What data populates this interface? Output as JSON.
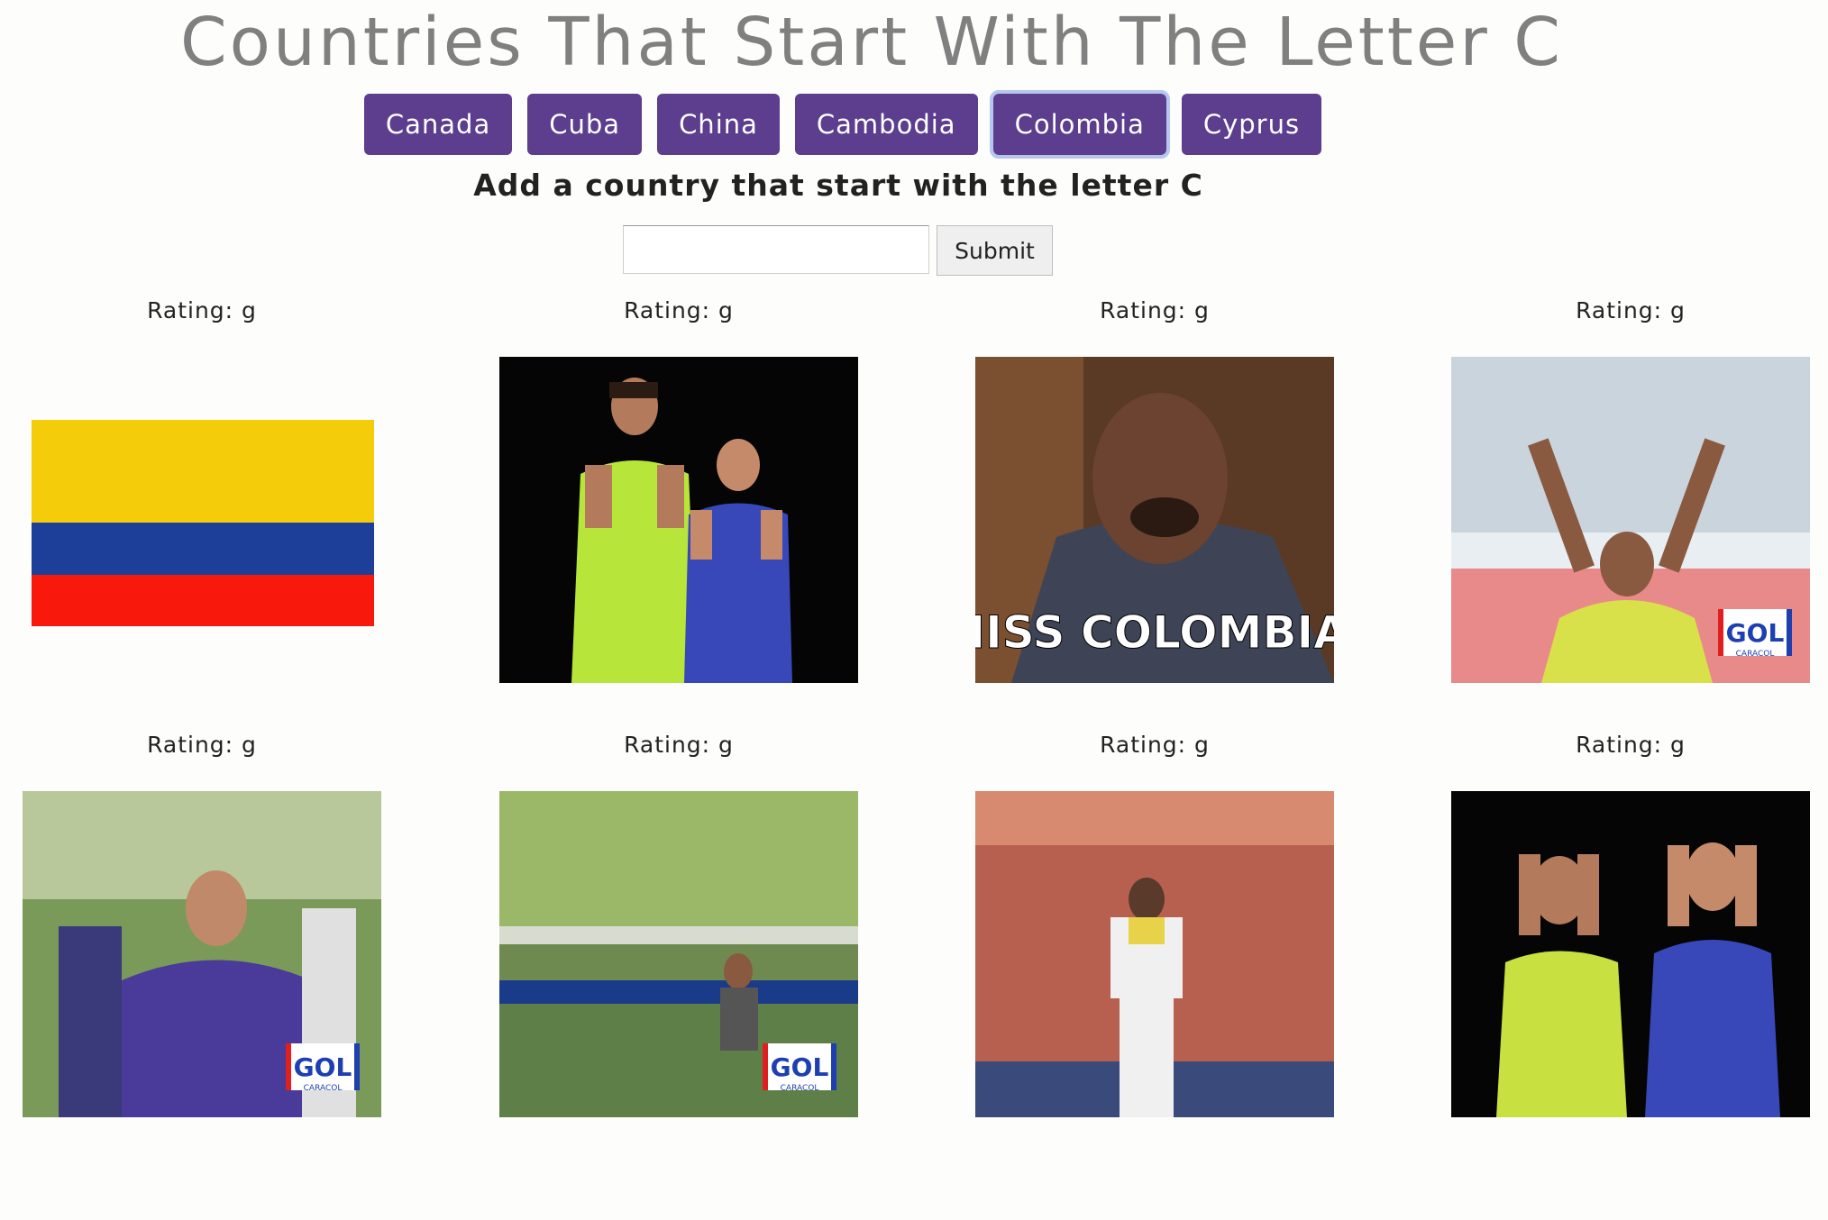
{
  "page": {
    "title": "Countries That Start With The Letter C"
  },
  "countries": [
    {
      "label": "Canada"
    },
    {
      "label": "Cuba"
    },
    {
      "label": "China"
    },
    {
      "label": "Cambodia"
    },
    {
      "label": "Colombia",
      "active": true
    },
    {
      "label": "Cyprus"
    }
  ],
  "add_form": {
    "heading": "Add a country that start with the letter C",
    "input_value": "",
    "input_placeholder": "",
    "submit_label": "Submit"
  },
  "gifs": [
    {
      "rating": "Rating: g",
      "subject": "colombia-flag"
    },
    {
      "rating": "Rating: g",
      "subject": "two-fans-cheering"
    },
    {
      "rating": "Rating: g",
      "subject": "miss-colombia-host",
      "caption": "MISS COLOMBIA!"
    },
    {
      "rating": "Rating: g",
      "subject": "player-celebrating",
      "badge": "GOL",
      "badge_sub": "CARACOL"
    },
    {
      "rating": "Rating: g",
      "subject": "goalkeeper-celebrating",
      "badge": "GOL",
      "badge_sub": "CARACOL"
    },
    {
      "rating": "Rating: g",
      "subject": "goalkeeper-on-pitch",
      "badge": "GOL",
      "badge_sub": "CARACOL"
    },
    {
      "rating": "Rating: g",
      "subject": "baseball-player"
    },
    {
      "rating": "Rating: g",
      "subject": "two-fans-disappointed"
    }
  ],
  "colors": {
    "button_purple": "#5c3d8e",
    "title_gray": "#808080",
    "flag_yellow": "#f5cc0a",
    "flag_blue": "#1d3f9a",
    "flag_red": "#f8190c"
  }
}
